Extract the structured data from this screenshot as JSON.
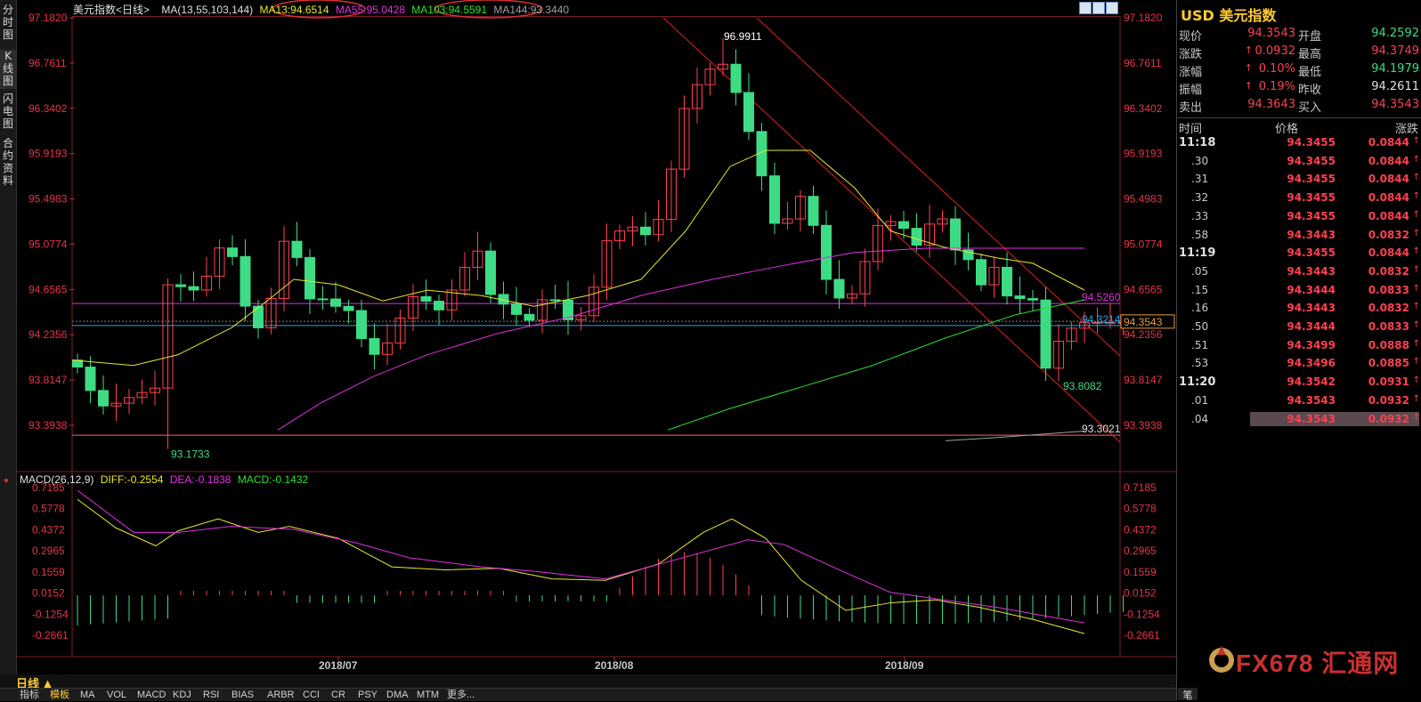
{
  "vtabs": [
    {
      "label": "分时图",
      "active": false
    },
    {
      "label": "K线图",
      "active": true
    },
    {
      "label": "闪电图",
      "active": false
    },
    {
      "label": "合约资料",
      "active": false
    }
  ],
  "chart_title": "美元指数",
  "period": "<日线>",
  "ma_legend": {
    "ma_label": "MA(13,55,103,144)",
    "ma13": "MA13:94.6514",
    "ma55": "MA55:95.0428",
    "ma103": "MA103:94.5591",
    "ma144": "MA144:93.3440"
  },
  "macd_legend": {
    "label": "MACD(26,12,9)",
    "diff": "DIFF:-0.2554",
    "dea": "DEA:-0.1838",
    "macd": "MACD:-0.1432"
  },
  "price_axis": [
    "97.1820",
    "96.7611",
    "96.3402",
    "95.9193",
    "95.4983",
    "95.0774",
    "94.6565",
    "94.2356",
    "93.8147",
    "93.3938"
  ],
  "macd_axis": [
    "0.7185",
    "0.5778",
    "0.4372",
    "0.2965",
    "0.1559",
    "0.0152",
    "-0.1254",
    "-0.2661"
  ],
  "date_axis": [
    "2018/07",
    "2018/08",
    "2018/09"
  ],
  "annotations": {
    "high": "96.9911",
    "low": "93.1733",
    "recent_low": "93.8082",
    "h_magenta": "94.5260",
    "h_blue": "94.3214",
    "h_pink": "93.3021",
    "current": "94.3543"
  },
  "colors": {
    "up": "#ff4050",
    "down": "#3ddc84",
    "ma13": "#e8e830",
    "ma55": "#e030e0",
    "ma103": "#30e030",
    "ma144": "#a0a0a0"
  },
  "quote": {
    "title": "USD 美元指数",
    "rows": [
      {
        "l": "现价",
        "v": "94.3543",
        "l2": "开盘",
        "v2": "94.2592",
        "c2": "#3ddc84"
      },
      {
        "l": "涨跌",
        "v": "0.0932",
        "l2": "最高",
        "v2": "94.3749",
        "c2": "#ff4050",
        "arrow": true
      },
      {
        "l": "涨幅",
        "v": "0.10%",
        "l2": "最低",
        "v2": "94.1979",
        "c2": "#3ddc84",
        "arrow": true
      },
      {
        "l": "振幅",
        "v": "0.19%",
        "l2": "昨收",
        "v2": "94.2611",
        "c2": "#e0e0e0",
        "arrow": true
      },
      {
        "l": "卖出",
        "v": "94.3643",
        "l2": "买入",
        "v2": "94.3543",
        "c2": "#ff4050"
      }
    ]
  },
  "ticks_header": {
    "time": "时间",
    "price": "价格",
    "change": "涨跌"
  },
  "ticks": [
    {
      "t": "11:18",
      "p": "94.3455",
      "c": "0.0844",
      "major": true
    },
    {
      "t": ".30",
      "p": "94.3455",
      "c": "0.0844"
    },
    {
      "t": ".31",
      "p": "94.3455",
      "c": "0.0844"
    },
    {
      "t": ".32",
      "p": "94.3455",
      "c": "0.0844"
    },
    {
      "t": ".33",
      "p": "94.3455",
      "c": "0.0844"
    },
    {
      "t": ".58",
      "p": "94.3443",
      "c": "0.0832"
    },
    {
      "t": "11:19",
      "p": "94.3455",
      "c": "0.0844",
      "major": true
    },
    {
      "t": ".05",
      "p": "94.3443",
      "c": "0.0832"
    },
    {
      "t": ".15",
      "p": "94.3444",
      "c": "0.0833"
    },
    {
      "t": ".16",
      "p": "94.3443",
      "c": "0.0832"
    },
    {
      "t": ".50",
      "p": "94.3444",
      "c": "0.0833"
    },
    {
      "t": ".51",
      "p": "94.3499",
      "c": "0.0888"
    },
    {
      "t": ".53",
      "p": "94.3496",
      "c": "0.0885"
    },
    {
      "t": "11:20",
      "p": "94.3542",
      "c": "0.0931",
      "major": true
    },
    {
      "t": ".01",
      "p": "94.3543",
      "c": "0.0932"
    },
    {
      "t": ".04",
      "p": "94.3543",
      "c": "0.0932",
      "selected": true
    }
  ],
  "bottom": {
    "period_button": "日线 ▲",
    "indicators": [
      "指标",
      "模板",
      "MA",
      "VOL",
      "MACD",
      "KDJ",
      "RSI",
      "BIAS",
      "ARBR",
      "CCI",
      "CR",
      "PSY",
      "DMA",
      "MTM",
      "更多..."
    ],
    "pen": "笔"
  },
  "logo": {
    "text": "FX678",
    "cn": "汇通网"
  }
}
